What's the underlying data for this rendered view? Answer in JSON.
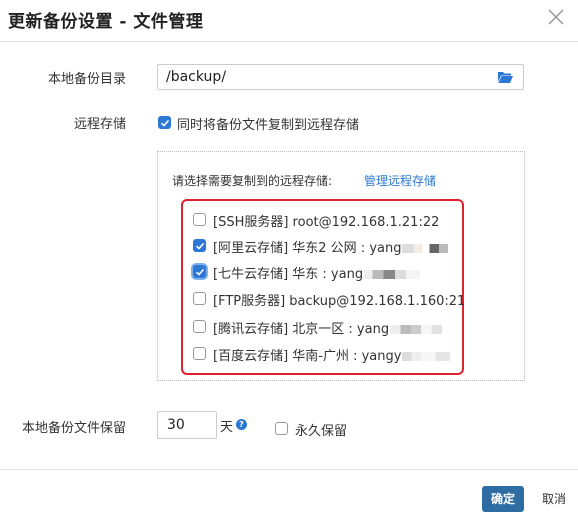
{
  "dialog": {
    "title": "更新备份设置 - 文件管理"
  },
  "form": {
    "local_dir_label": "本地备份目录",
    "local_dir_value": "/backup/",
    "remote_label": "远程存储",
    "copy_remote_label": "同时将备份文件复制到远程存储",
    "copy_remote_checked": true,
    "choose_remote_label": "请选择需要复制到的远程存储:",
    "manage_remote_link": "管理远程存储",
    "storages": [
      {
        "label": "[SSH服务器] root@192.168.1.21:22",
        "checked": false
      },
      {
        "label": "[阿里云存储] 华东2 公网 : yang",
        "checked": true
      },
      {
        "label": "[七牛云存储] 华东 : yang",
        "checked": true
      },
      {
        "label": "[FTP服务器] backup@192.168.1.160:21",
        "checked": false
      },
      {
        "label": "[腾讯云存储] 北京一区 : yang",
        "checked": false
      },
      {
        "label": "[百度云存储] 华南-广州 : yangy",
        "checked": false
      }
    ],
    "keep_label": "本地备份文件保留",
    "keep_days": "30",
    "keep_unit": "天",
    "forever_label": "永久保留",
    "forever_checked": false
  },
  "footer": {
    "ok_label": "确定",
    "cancel_label": "取消"
  },
  "colors": {
    "accent": "#2c78d4",
    "ok_button": "#2e6da4",
    "highlight_border": "#e0212e"
  },
  "icons": [
    "close-icon",
    "folder-open-icon",
    "question-icon",
    "checkbox-checked-icon"
  ]
}
